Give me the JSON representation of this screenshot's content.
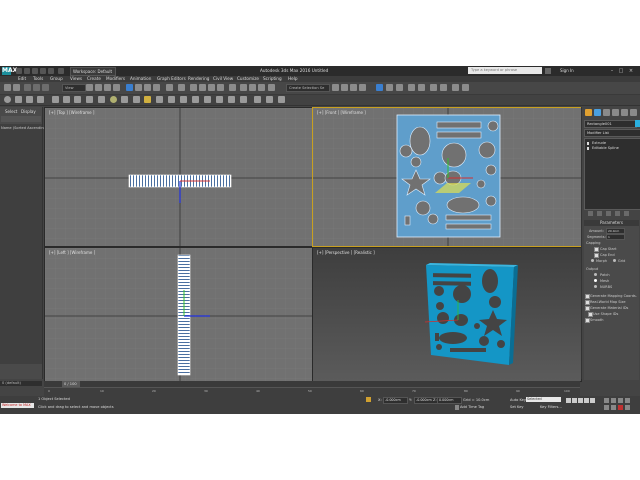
{
  "window": {
    "title": "Autodesk 3ds Max 2016    Untitled",
    "workspace": "Workspace: Default",
    "search_placeholder": "Type a keyword or phrase",
    "sign_in": "Sign In",
    "logo": "MAX"
  },
  "menus": [
    "Edit",
    "Tools",
    "Group",
    "Views",
    "Create",
    "Modifiers",
    "Animation",
    "Graph Editors",
    "Rendering",
    "Civil View",
    "Customize",
    "Scripting",
    "Help"
  ],
  "toolbar": {
    "ref_coord": "View",
    "selection_set": "Create Selection Se"
  },
  "scene_explorer": {
    "tab_select": "Select",
    "tab_display": "Display",
    "item": "Name (Sorted Ascending)",
    "layer": "0 (default)"
  },
  "viewports": {
    "top": "[+] [Top ] [Wireframe ]",
    "front": "[+] [Front ] [Wireframe ]",
    "left": "[+] [Left ] [Wireframe ]",
    "perspective": "[+] [Perspective ] [Realistic ]"
  },
  "command_panel": {
    "object_name": "Rectangle001",
    "object_color": "#2ab0e0",
    "modifier_list": "Modifier List",
    "stack": [
      "Extrude",
      "Editable Spline"
    ],
    "parameters_title": "Parameters",
    "amount_label": "Amount:",
    "amount_value": "20.0cm",
    "segments_label": "Segments:",
    "segments_value": "1",
    "capping_label": "Capping",
    "cap_start": "Cap Start",
    "cap_end": "Cap End",
    "morph": "Morph",
    "grid": "Grid",
    "output_label": "Output",
    "output_patch": "Patch",
    "output_mesh": "Mesh",
    "output_nurbs": "NURBS",
    "gen_mapping": "Generate Mapping Coords.",
    "real_world": "Real-World Map Size",
    "gen_material": "Generate Material IDs",
    "use_shape_ids": "Use Shape IDs",
    "smooth": "Smooth"
  },
  "timeline": {
    "frame_display": "0 / 100",
    "ticks": [
      "0",
      "10",
      "20",
      "30",
      "40",
      "50",
      "60",
      "70",
      "80",
      "90",
      "100"
    ]
  },
  "status": {
    "maxscript": "Welcome to MAX",
    "selected": "1 Object Selected",
    "prompt": "Click and drag to select and move objects",
    "x_label": "X:",
    "x_value": "-0.000cm",
    "y_label": "Y:",
    "y_value": "-0.000cm",
    "z_label": "Z:",
    "z_value": "0.000cm",
    "grid": "Grid = 10.0cm",
    "add_time_tag": "Add Time Tag",
    "auto_key": "Auto Key",
    "set_key": "Set Key",
    "selected_dropdown": "Selected",
    "key_filters": "Key Filters..."
  }
}
